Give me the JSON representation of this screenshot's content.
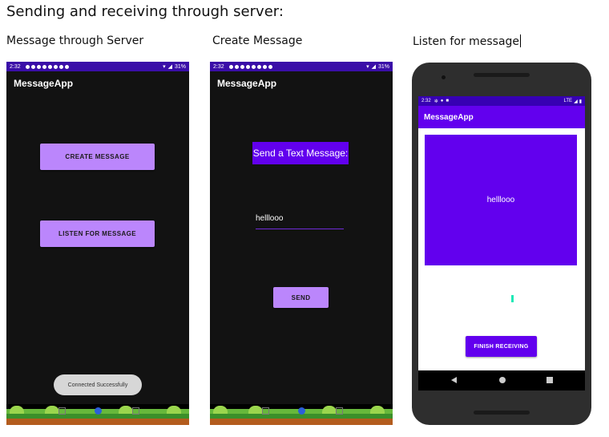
{
  "doc": {
    "heading": "Sending and receiving through server:",
    "captions": [
      "Message through Server",
      "Create Message",
      "Listen for message"
    ]
  },
  "screen1": {
    "status_time": "2:32",
    "status_battery": "31%",
    "app_title": "MessageApp",
    "create_button": "CREATE MESSAGE",
    "listen_button": "LISTEN FOR MESSAGE",
    "toast": "Connected Successfully"
  },
  "screen2": {
    "status_time": "2:32",
    "status_battery": "31%",
    "app_title": "MessageApp",
    "label": "Send a Text Message:",
    "input_value": "helllooo",
    "send_button": "SEND"
  },
  "screen3": {
    "status_time": "2:32",
    "status_signal": "LTE",
    "app_title": "MessageApp",
    "message": "helllooo",
    "finish_button": "FINISH RECEIVING"
  },
  "colors": {
    "primary": "#6200ee",
    "secondary": "#bb86fc",
    "status_dark": "#3700b3",
    "accent": "#1de9b6"
  }
}
